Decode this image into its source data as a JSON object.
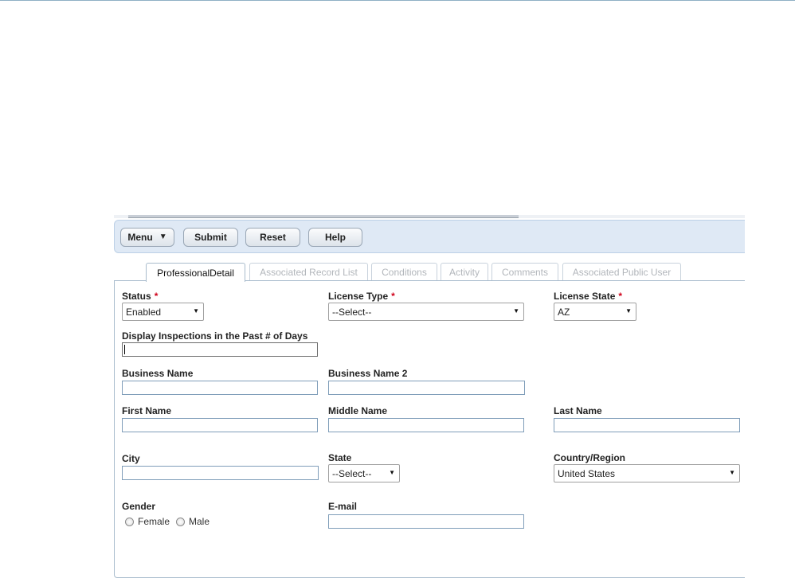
{
  "toolbar": {
    "menu_label": "Menu",
    "submit_label": "Submit",
    "reset_label": "Reset",
    "help_label": "Help"
  },
  "tabs": [
    {
      "label": "ProfessionalDetail",
      "active": true
    },
    {
      "label": "Associated Record List",
      "active": false
    },
    {
      "label": "Conditions",
      "active": false
    },
    {
      "label": "Activity",
      "active": false
    },
    {
      "label": "Comments",
      "active": false
    },
    {
      "label": "Associated Public User",
      "active": false
    }
  ],
  "form": {
    "required_marker": "*",
    "status": {
      "label": "Status",
      "value": "Enabled"
    },
    "license_type": {
      "label": "License Type",
      "value": "--Select--"
    },
    "license_state": {
      "label": "License State",
      "value": "AZ"
    },
    "display_inspections": {
      "label": "Display Inspections in the Past # of Days",
      "value": ""
    },
    "business_name": {
      "label": "Business Name",
      "value": ""
    },
    "business_name_2": {
      "label": "Business Name 2",
      "value": ""
    },
    "first_name": {
      "label": "First Name",
      "value": ""
    },
    "middle_name": {
      "label": "Middle Name",
      "value": ""
    },
    "last_name": {
      "label": "Last Name",
      "value": ""
    },
    "city": {
      "label": "City",
      "value": ""
    },
    "state": {
      "label": "State",
      "value": "--Select--"
    },
    "country_region": {
      "label": "Country/Region",
      "value": "United States"
    },
    "gender": {
      "label": "Gender",
      "options": [
        "Female",
        "Male"
      ]
    },
    "email": {
      "label": "E-mail",
      "value": ""
    }
  }
}
